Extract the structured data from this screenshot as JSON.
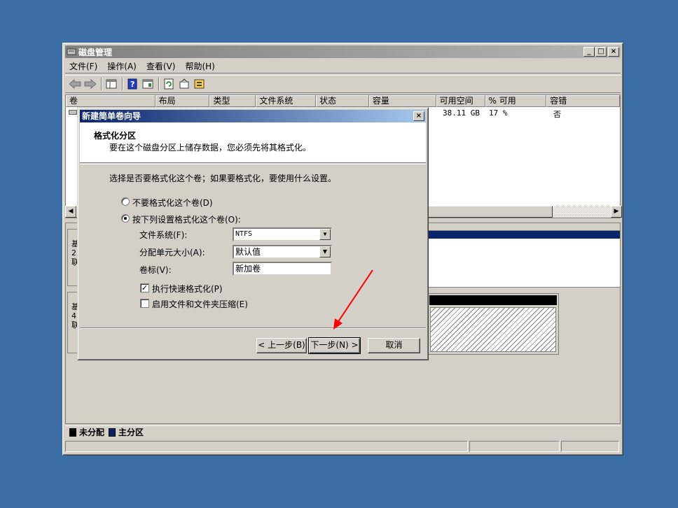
{
  "window": {
    "title": "磁盘管理",
    "controls": [
      "_",
      "□",
      "×"
    ]
  },
  "menu": [
    "文件(F)",
    "操作(A)",
    "查看(V)",
    "帮助(H)"
  ],
  "volume_list": {
    "columns": [
      "卷",
      "布局",
      "类型",
      "文件系统",
      "状态",
      "容量",
      "可用空间",
      "% 可用",
      "容错"
    ],
    "row": {
      "free": "38.11 GB",
      "pct": "17 %",
      "fault": "否"
    }
  },
  "disk_partial_labels": {
    "disk0": [
      "基",
      "2:",
      "联"
    ],
    "disk1": [
      "基",
      "4(",
      "联"
    ]
  },
  "legend": [
    {
      "label": "未分配",
      "color": "#000000"
    },
    {
      "label": "主分区",
      "color": "#0a246a"
    }
  ],
  "dialog": {
    "title": "新建简单卷向导",
    "header_title": "格式化分区",
    "header_desc": "要在这个磁盘分区上储存数据，您必须先将其格式化。",
    "prompt": "选择是否要格式化这个卷；如果要格式化，要使用什么设置。",
    "opt_no_format": "不要格式化这个卷(D)",
    "opt_format": "按下列设置格式化这个卷(O):",
    "fs_label": "文件系统(F):",
    "fs_value": "NTFS",
    "alloc_label": "分配单元大小(A):",
    "alloc_value": "默认值",
    "vol_label": "卷标(V):",
    "vol_value": "新加卷",
    "quick_format": "执行快速格式化(P)",
    "compress": "启用文件和文件夹压缩(E)",
    "back_btn": "< 上一步(B)",
    "next_btn": "下一步(N) >",
    "cancel_btn": "取消"
  },
  "annotation": {
    "color": "#ff0000"
  }
}
